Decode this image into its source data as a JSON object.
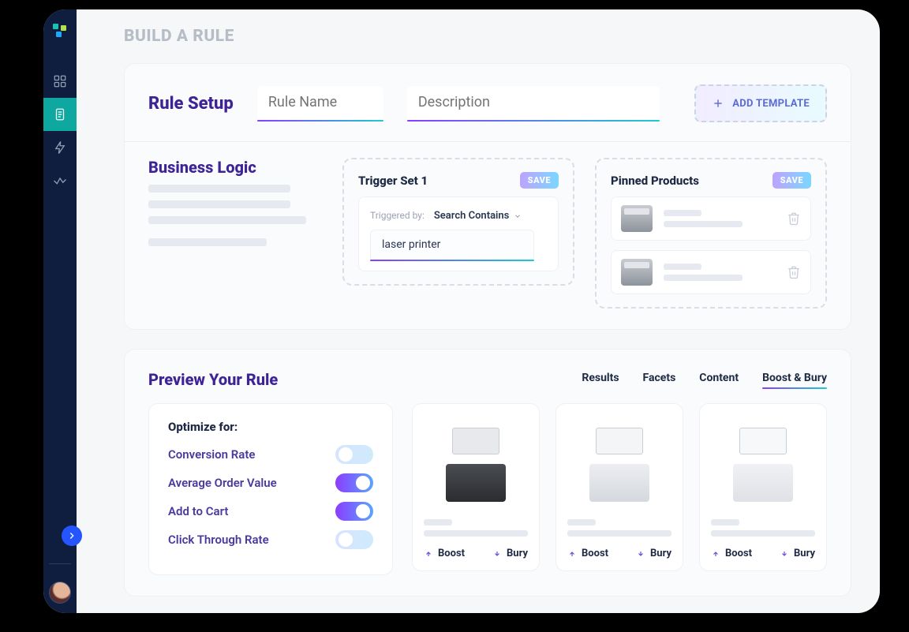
{
  "page_title": "BUILD A RULE",
  "sidebar": {
    "items": [
      {
        "name": "dashboard",
        "active": false
      },
      {
        "name": "rules",
        "active": true
      },
      {
        "name": "automation",
        "active": false
      },
      {
        "name": "analytics",
        "active": false
      }
    ]
  },
  "setup": {
    "title": "Rule Setup",
    "name_placeholder": "Rule Name",
    "desc_placeholder": "Description",
    "add_template_label": "ADD TEMPLATE"
  },
  "logic": {
    "title": "Business Logic",
    "trigger": {
      "title": "Trigger Set 1",
      "save_label": "SAVE",
      "triggered_by_label": "Triggered by:",
      "mode_label": "Search Contains",
      "query": "laser printer"
    },
    "pinned": {
      "title": "Pinned Products",
      "save_label": "SAVE"
    }
  },
  "preview": {
    "title": "Preview Your Rule",
    "tabs": [
      "Results",
      "Facets",
      "Content",
      "Boost & Bury"
    ],
    "active_tab": 3,
    "optimize": {
      "title": "Optimize for:",
      "rows": [
        {
          "label": "Conversion Rate",
          "on": false
        },
        {
          "label": "Average Order Value",
          "on": true
        },
        {
          "label": "Add to Cart",
          "on": true
        },
        {
          "label": "Click Through Rate",
          "on": false
        }
      ]
    },
    "actions": {
      "boost": "Boost",
      "bury": "Bury"
    }
  }
}
